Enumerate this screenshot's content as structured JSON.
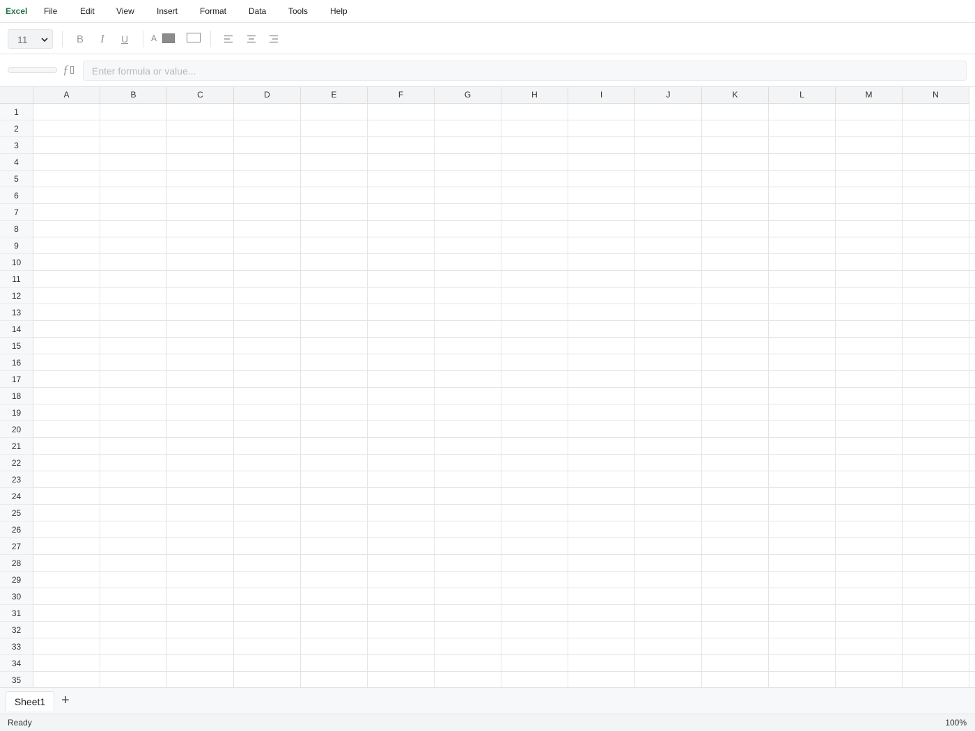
{
  "app": {
    "name": "Excel"
  },
  "menu": [
    "File",
    "Edit",
    "View",
    "Insert",
    "Format",
    "Data",
    "Tools",
    "Help"
  ],
  "toolbar": {
    "font_size": "11",
    "bold_label": "B",
    "italic_label": "I",
    "underline_label": "U",
    "font_color_label": "A",
    "font_color": "#8c8c8c"
  },
  "formula": {
    "fx_label": "ƒ",
    "name_box": "",
    "placeholder": "Enter formula or value..."
  },
  "grid": {
    "columns": [
      "A",
      "B",
      "C",
      "D",
      "E",
      "F",
      "G",
      "H",
      "I",
      "J",
      "K",
      "L",
      "M",
      "N"
    ],
    "rows": [
      "1",
      "2",
      "3",
      "4",
      "5",
      "6",
      "7",
      "8",
      "9",
      "10",
      "11",
      "12",
      "13",
      "14",
      "15",
      "16",
      "17",
      "18",
      "19",
      "20",
      "21",
      "22",
      "23",
      "24",
      "25",
      "26",
      "27",
      "28",
      "29",
      "30",
      "31",
      "32",
      "33",
      "34",
      "35"
    ]
  },
  "sheets": [
    {
      "name": "Sheet1",
      "active": true
    }
  ],
  "add_sheet_label": "+",
  "status": {
    "text": "Ready",
    "zoom": "100%"
  }
}
